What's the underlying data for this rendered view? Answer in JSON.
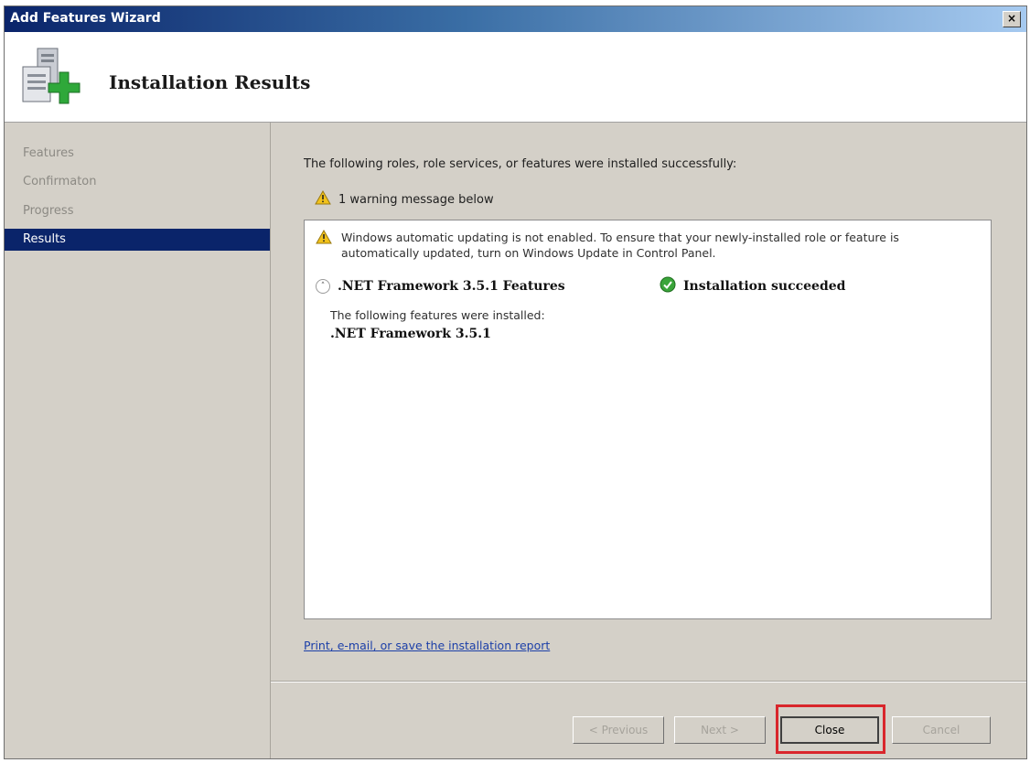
{
  "window": {
    "title": "Add Features Wizard",
    "close_label": "×"
  },
  "header": {
    "title": "Installation Results",
    "icon": "server-add-feature-icon"
  },
  "sidebar": {
    "items": [
      {
        "label": "Features",
        "state": "done"
      },
      {
        "label": "Confirmaton",
        "state": "done"
      },
      {
        "label": "Progress",
        "state": "done"
      },
      {
        "label": "Results",
        "state": "active"
      }
    ]
  },
  "main": {
    "intro": "The following roles, role services, or features were installed successfully:",
    "warning_summary": "1 warning message below",
    "results": {
      "warning_message": "Windows automatic updating is not enabled. To ensure that your newly-installed role or feature is automatically updated, turn on Windows Update in Control Panel.",
      "feature_name": ".NET Framework 3.5.1 Features",
      "status": "Installation succeeded",
      "installed_label": "The following features were installed:",
      "installed_items": [
        ".NET Framework 3.5.1"
      ]
    },
    "report_link": "Print, e-mail, or save the installation report"
  },
  "buttons": {
    "previous": "< Previous",
    "next": "Next >",
    "close": "Close",
    "cancel": "Cancel"
  },
  "colors": {
    "title_bar": "#0a246a",
    "selected_nav": "#0a246a",
    "highlight": "#d9262c",
    "success": "#3aa53a",
    "warning": "#f2c21b"
  }
}
